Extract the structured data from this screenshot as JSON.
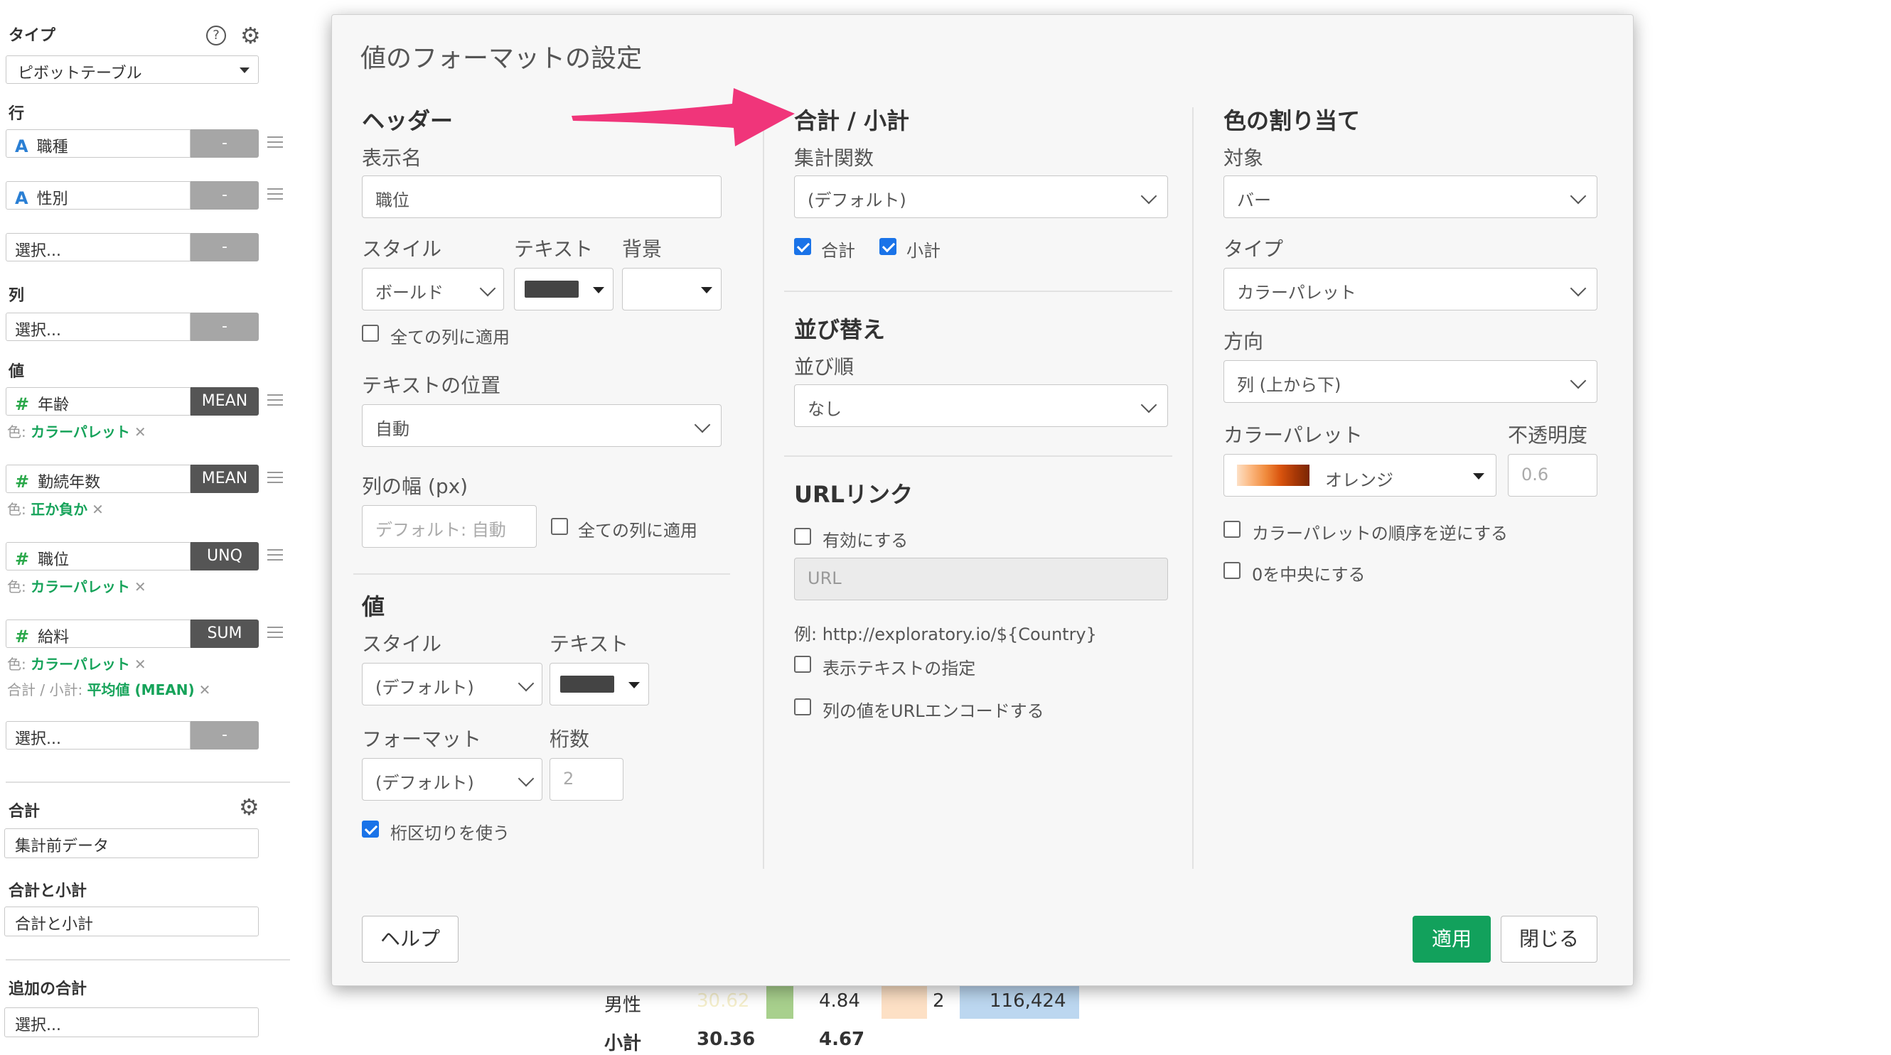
{
  "sidebar": {
    "type_label": "タイプ",
    "type_value": "ピボットテーブル",
    "rows_label": "行",
    "rows": [
      {
        "icon": "A",
        "name": "職種",
        "btn": "-"
      },
      {
        "icon": "A",
        "name": "性別",
        "btn": "-"
      },
      {
        "icon": "",
        "name": "選択...",
        "btn": "-"
      }
    ],
    "columns_label": "列",
    "columns": [
      {
        "name": "選択...",
        "btn": "-"
      }
    ],
    "values_label": "値",
    "values": [
      {
        "icon": "#",
        "name": "年齢",
        "agg": "MEAN",
        "color_prefix": "色: ",
        "color_value": "カラーパレット",
        "x": "✕"
      },
      {
        "icon": "#",
        "name": "勤続年数",
        "agg": "MEAN",
        "color_prefix": "色: ",
        "color_value": "正か負か",
        "x": "✕"
      },
      {
        "icon": "#",
        "name": "職位",
        "agg": "UNQ",
        "color_prefix": "色: ",
        "color_value": "カラーパレット",
        "x": "✕"
      },
      {
        "icon": "#",
        "name": "給料",
        "agg": "SUM",
        "color_prefix": "色: ",
        "color_value": "カラーパレット",
        "x": "✕",
        "total_prefix": "合計 / 小計: ",
        "total_value": "平均値 (MEAN)",
        "total_x": "✕"
      }
    ],
    "values_select": {
      "name": "選択...",
      "btn": "-"
    },
    "total_label": "合計",
    "total_value": "集計前データ",
    "total_subtotal_label": "合計と小計",
    "total_subtotal_value": "合計と小計",
    "extra_total_label": "追加の合計",
    "extra_total_value": "選択..."
  },
  "background_table": {
    "row1": {
      "label": "男性",
      "v1": "30.62",
      "v2": "4.84",
      "v3": "2",
      "v4": "116,424"
    },
    "row2": {
      "label": "小計",
      "v1": "30.36",
      "v2": "4.67"
    }
  },
  "dialog": {
    "title": "値のフォーマットの設定",
    "header": {
      "heading": "ヘッダー",
      "display_name_label": "表示名",
      "display_name_value": "職位",
      "style_label": "スタイル",
      "style_value": "ボールド",
      "text_label": "テキスト",
      "bg_label": "背景",
      "apply_all_label": "全ての列に適用",
      "text_pos_label": "テキストの位置",
      "text_pos_value": "自動",
      "col_width_label": "列の幅 (px)",
      "col_width_placeholder": "デフォルト: 自動",
      "col_width_apply_all": "全ての列に適用"
    },
    "value": {
      "heading": "値",
      "style_label": "スタイル",
      "style_value": "(デフォルト)",
      "text_label": "テキスト",
      "format_label": "フォーマット",
      "format_value": "(デフォルト)",
      "digits_label": "桁数",
      "digits_placeholder": "2",
      "thousands_label": "桁区切りを使う"
    },
    "totals": {
      "heading": "合計 / 小計",
      "agg_label": "集計関数",
      "agg_value": "(デフォルト)",
      "total_label": "合計",
      "subtotal_label": "小計"
    },
    "sort": {
      "heading": "並び替え",
      "order_label": "並び順",
      "order_value": "なし"
    },
    "url": {
      "heading": "URLリンク",
      "enable_label": "有効にする",
      "url_placeholder": "URL",
      "example": "例: http://exploratory.io/${Country}",
      "display_text_label": "表示テキストの指定",
      "encode_label": "列の値をURLエンコードする"
    },
    "color": {
      "heading": "色の割り当て",
      "target_label": "対象",
      "target_value": "バー",
      "type_label": "タイプ",
      "type_value": "カラーパレット",
      "direction_label": "方向",
      "direction_value": "列 (上から下)",
      "palette_label": "カラーパレット",
      "palette_value": "オレンジ",
      "opacity_label": "不透明度",
      "opacity_placeholder": "0.6",
      "reverse_label": "カラーパレットの順序を逆にする",
      "center_zero_label": "0を中央にする"
    },
    "help_button": "ヘルプ",
    "apply_button": "適用",
    "close_button": "閉じる"
  },
  "colors": {
    "accent_green": "#12a15c",
    "arrow_pink": "#f0357a",
    "checkbox_blue": "#1a73e8"
  }
}
